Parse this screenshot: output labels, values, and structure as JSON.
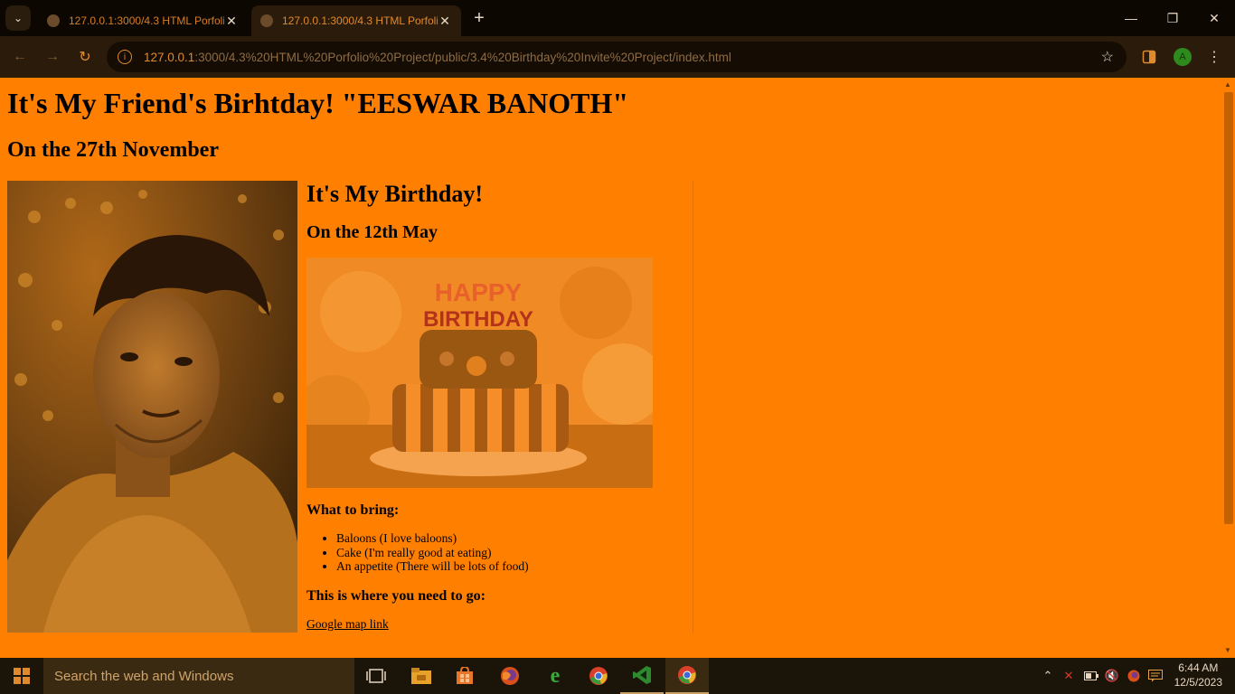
{
  "browser": {
    "tabs": [
      {
        "title": "127.0.0.1:3000/4.3 HTML Porfolio"
      },
      {
        "title": "127.0.0.1:3000/4.3 HTML Porfolio"
      }
    ],
    "url_host": "127.0.0.1",
    "url_path": ":3000/4.3%20HTML%20Porfolio%20Project/public/3.4%20Birthday%20Invite%20Project/index.html",
    "profile_initial": "A"
  },
  "page": {
    "heading": "It's My Friend's Birhtday! \"EESWAR BANOTH\"",
    "subheading": "On the 27th November",
    "card_heading": "It's My Birthday!",
    "card_subheading": "On the 12th May",
    "cake_text_top": "HAPPY",
    "cake_text_bottom": "BIRTHDAY",
    "bring_heading": "What to bring:",
    "bring_items": [
      "Baloons (I love baloons)",
      "Cake (I'm really good at eating)",
      "An appetite (There will be lots of food)"
    ],
    "go_heading": "This is where you need to go:",
    "map_link": "Google map link"
  },
  "taskbar": {
    "search_placeholder": "Search the web and Windows",
    "time": "6:44 AM",
    "date": "12/5/2023"
  },
  "colors": {
    "page_bg": "#ff7f00",
    "accent": "#e08a2e"
  }
}
